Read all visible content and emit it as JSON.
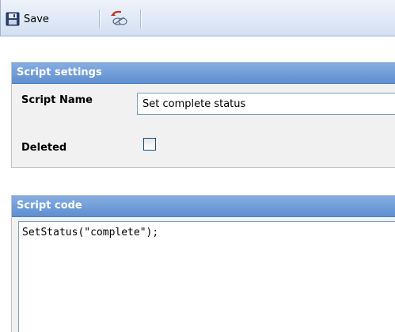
{
  "toolbar": {
    "save_label": "Save",
    "save_icon": "floppy-disk-icon",
    "undo_icon": "undo-icon"
  },
  "settings": {
    "header": "Script settings",
    "name_label": "Script Name",
    "name_value": "Set complete status",
    "deleted_label": "Deleted",
    "deleted_checked": false
  },
  "code": {
    "header": "Script code",
    "value": "SetStatus(\"complete\");"
  },
  "colors": {
    "header_bg": "#6f9bd8",
    "panel_bg": "#f1f1f1",
    "toolbar_bg": "#dbe6f5"
  }
}
